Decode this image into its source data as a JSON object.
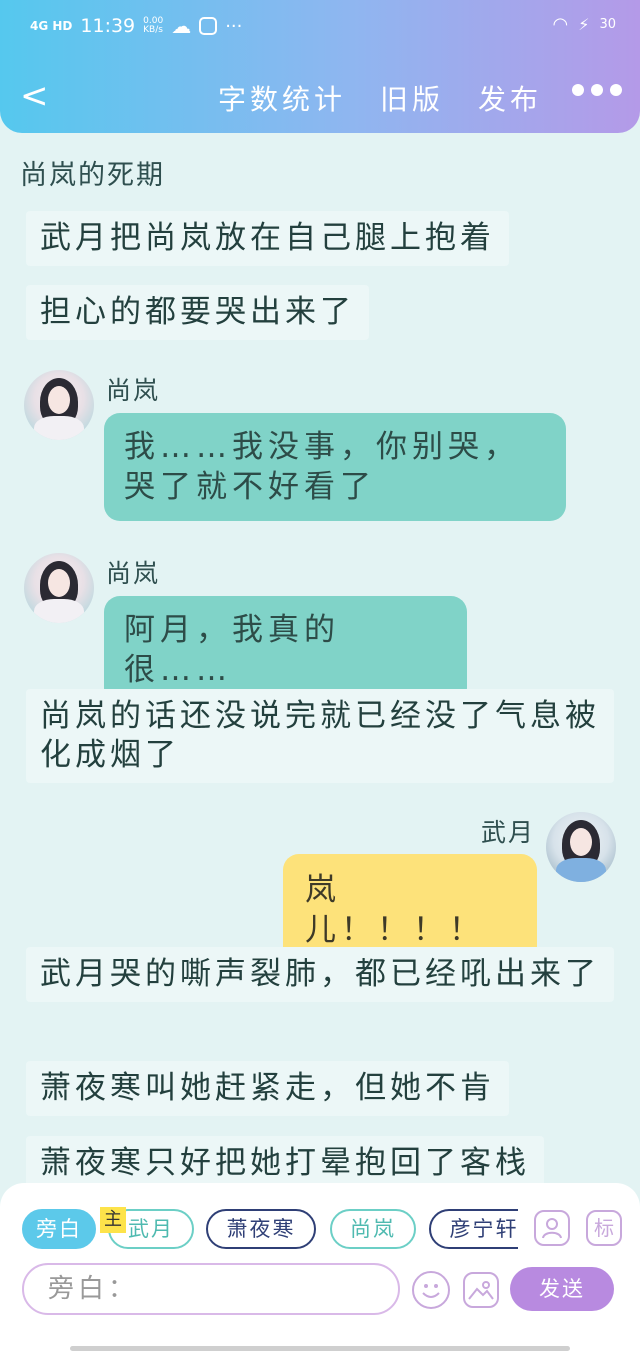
{
  "status_bar": {
    "network": "4G HD",
    "time": "11:39",
    "speed_value": "0.00",
    "speed_unit": "KB/s",
    "more": "···",
    "battery": "30"
  },
  "nav": {
    "back": "<",
    "items": [
      "字数统计",
      "旧版",
      "发布"
    ]
  },
  "chat": {
    "title": "尚岚的死期",
    "messages": [
      {
        "type": "narration",
        "text": "武月把尚岚放在自己腿上抱着"
      },
      {
        "type": "narration",
        "text": "担心的都要哭出来了"
      },
      {
        "type": "left",
        "speaker": "尚岚",
        "text": "我……我没事，你别哭，哭了就不好看了"
      },
      {
        "type": "left",
        "speaker": "尚岚",
        "text": "阿月，我真的很……"
      },
      {
        "type": "narration",
        "text": "尚岚的话还没说完就已经没了气息被化成烟了"
      },
      {
        "type": "right",
        "speaker": "武月",
        "text": "岚儿！！！！"
      },
      {
        "type": "narration",
        "text": "武月哭的嘶声裂肺，都已经吼出来了"
      },
      {
        "type": "narration",
        "text": "萧夜寒叫她赶紧走，但她不肯"
      },
      {
        "type": "narration",
        "text": "萧夜寒只好把她打晕抱回了客栈"
      }
    ]
  },
  "composer": {
    "chips": [
      "旁白",
      "武月",
      "萧夜寒",
      "尚岚",
      "彦宁轩"
    ],
    "main_tag": "主",
    "role_icon": "person-icon",
    "tag_label": "标",
    "input_placeholder": "旁白：",
    "send_label": "发送"
  },
  "colors": {
    "header_start": "#55c8ee",
    "header_end": "#b49ae8",
    "left_bubble": "#80d3c8",
    "right_bubble": "#fde27a",
    "send": "#b88ae0"
  }
}
